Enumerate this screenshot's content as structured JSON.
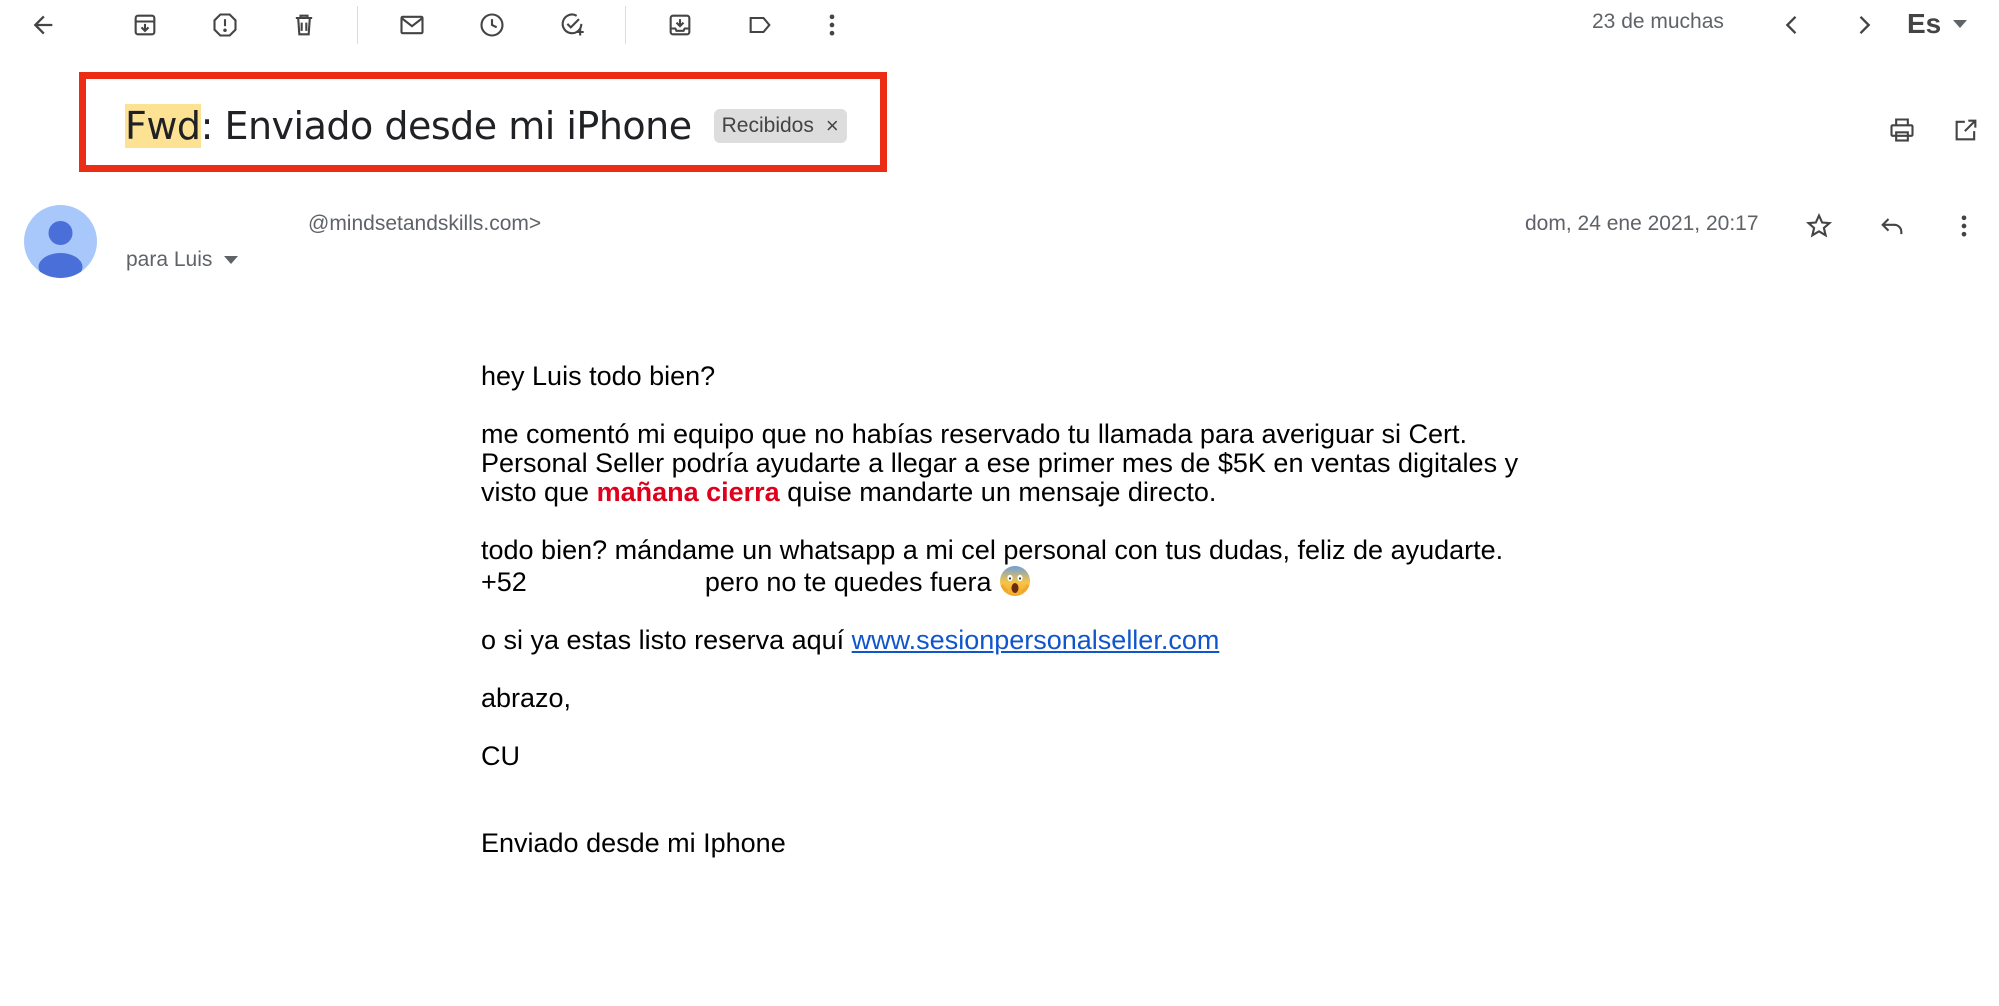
{
  "toolbar": {
    "icons": [
      "back-arrow-icon",
      "archive-icon",
      "report-spam-icon",
      "delete-icon",
      "mark-unread-icon",
      "snooze-icon",
      "add-task-icon",
      "move-to-icon",
      "label-icon",
      "more-vert-icon"
    ],
    "counter": "23 de muchas",
    "lang": "Es"
  },
  "email": {
    "subject_prefix": "Fwd",
    "subject_rest": ": Enviado desde mi iPhone",
    "label_chip": "Recibidos",
    "chip_close": "×",
    "sender_email": "@mindsetandskills.com>",
    "recipient": "para Luis",
    "date": "dom, 24 ene 2021, 20:17"
  },
  "body": {
    "greeting": "hey Luis todo bien?",
    "p1_line1": "me comentó mi equipo que no habías reservado tu llamada para averiguar si Cert.",
    "p1_line2": "Personal Seller podría ayudarte a llegar a ese primer mes de $5K en ventas digitales y",
    "p1_line3_a": "visto que ",
    "p1_line3_red": "mañana cierra",
    "p1_line3_b": " quise mandarte un mensaje directo.",
    "p2_line1": "todo bien? mándame un whatsapp a mi cel personal con tus dudas, feliz de ayudarte.",
    "p2_phone": "+52",
    "p2_line2_b": "pero no te quedes fuera",
    "p3_text": "o si ya estas listo reserva aquí ",
    "p3_link": "www.sesionpersonalseller.com",
    "closing": "abrazo,",
    "signature": "CU",
    "footer": "Enviado desde mi Iphone"
  },
  "colors": {
    "highlight_box": "#ea2d14",
    "fwd_highlight": "#fde293",
    "urgent_red": "#e0001b",
    "link_blue": "#1155cc",
    "avatar_bg": "#a8c7fa"
  }
}
